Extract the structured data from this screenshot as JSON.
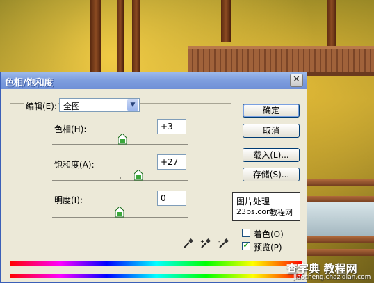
{
  "dialog": {
    "title": "色相/饱和度",
    "close_icon": "close-icon",
    "edit": {
      "label": "编辑(E):",
      "value": "全图"
    },
    "sliders": [
      {
        "label": "色相(H):",
        "value": "+3"
      },
      {
        "label": "饱和度(A):",
        "value": "+27"
      },
      {
        "label": "明度(I):",
        "value": "0"
      }
    ],
    "buttons": {
      "ok": "确定",
      "cancel": "取消",
      "load": "载入(L)...",
      "save": "存储(S)..."
    },
    "logo": {
      "line1": "图片处理",
      "line2": "23ps.com",
      "line3": "教程网"
    },
    "checkboxes": [
      {
        "label": "着色(O)",
        "checked": false
      },
      {
        "label": "预览(P)",
        "checked": true
      }
    ],
    "eyedroppers": [
      "eyedropper-icon",
      "eyedropper-plus-icon",
      "eyedropper-minus-icon"
    ]
  },
  "watermark": {
    "line1": "查字典 教程网",
    "line2": "jiaocheng.chazidian.com"
  }
}
